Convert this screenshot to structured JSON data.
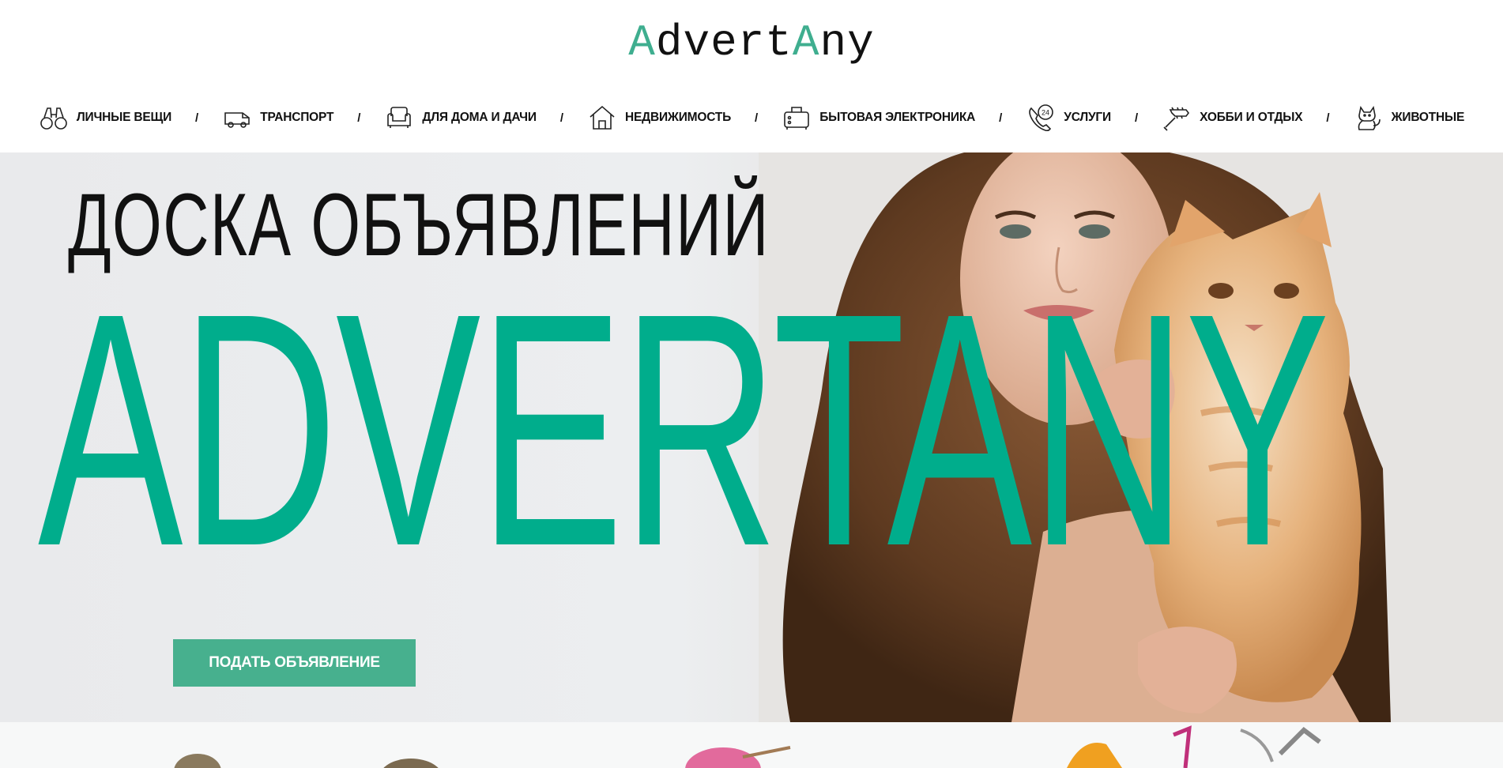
{
  "logo": {
    "part1": "A",
    "part2": "dvert",
    "part3": "A",
    "part4": "ny"
  },
  "nav": {
    "items": [
      {
        "label": "ЛИЧНЫЕ ВЕЩИ",
        "icon": "binoculars-icon"
      },
      {
        "label": "ТРАНСПОРТ",
        "icon": "van-icon"
      },
      {
        "label": "ДЛЯ ДОМА И ДАЧИ",
        "icon": "armchair-icon"
      },
      {
        "label": "НЕДВИЖИМОСТЬ",
        "icon": "house-icon"
      },
      {
        "label": "БЫТОВАЯ ЭЛЕКТРОНИКА",
        "icon": "toaster-icon"
      },
      {
        "label": "УСЛУГИ",
        "icon": "phone-24-icon"
      },
      {
        "label": "ХОББИ И ОТДЫХ",
        "icon": "guitar-icon"
      },
      {
        "label": "ЖИВОТНЫЕ",
        "icon": "cat-icon"
      }
    ],
    "separator": "/",
    "icon_24_text": "24"
  },
  "hero": {
    "title": "ДОСКА ОБЪЯВЛЕНИЙ",
    "brand": "ADVERTANY",
    "cta_label": "ПОДАТЬ ОБЪЯВЛЕНИЕ"
  },
  "colors": {
    "accent": "#00ad8c",
    "button": "#47b08e",
    "logo_accent": "#3fae8f"
  }
}
